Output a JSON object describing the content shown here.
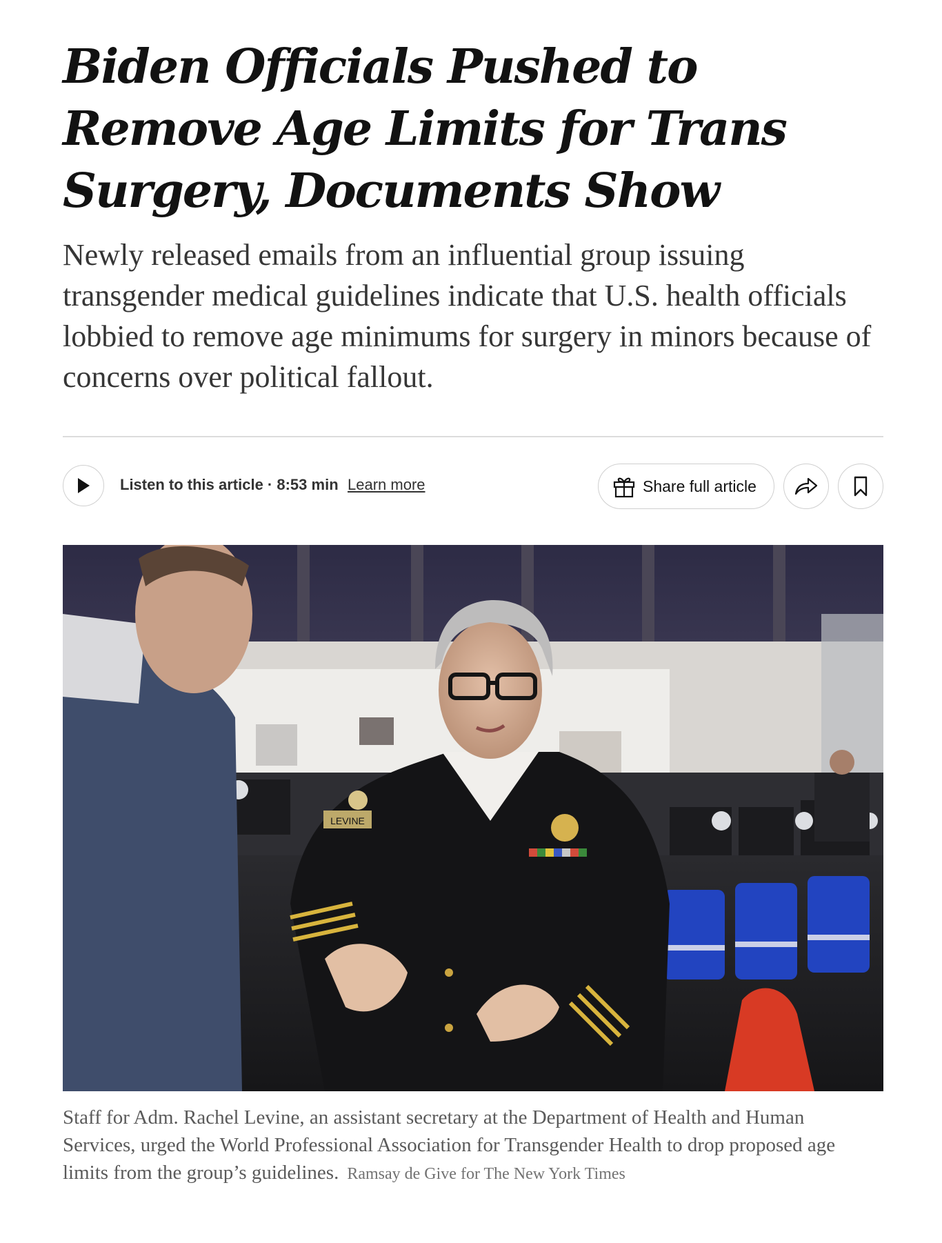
{
  "article": {
    "headline": "Biden Officials Pushed to Remove Age Limits for Trans Surgery, Documents Show",
    "summary": "Newly released emails from an influential group issuing transgender medical guidelines indicate that U.S. health officials lobbied to remove age minimums for surgery in minors because of concerns over political fallout."
  },
  "toolbar": {
    "listen_label": "Listen to this article · 8:53 min",
    "learn_more": "Learn more",
    "share_full": "Share full article",
    "icons": [
      "play-icon",
      "gift-icon",
      "share-arrow-icon",
      "bookmark-icon"
    ]
  },
  "photo": {
    "badge_text": "LEVINE"
  },
  "caption": {
    "text": "Staff for Adm. Rachel Levine, an assistant secretary at the Department of Health and Human Services, urged the World Professional Association for Transgender Health to drop proposed age limits from the group’s guidelines.",
    "credit": "Ramsay de Give for The New York Times"
  },
  "colors": {
    "text": "#121212",
    "summary": "#363636",
    "caption": "#5a5a5a",
    "rule": "#dcdcdc"
  }
}
